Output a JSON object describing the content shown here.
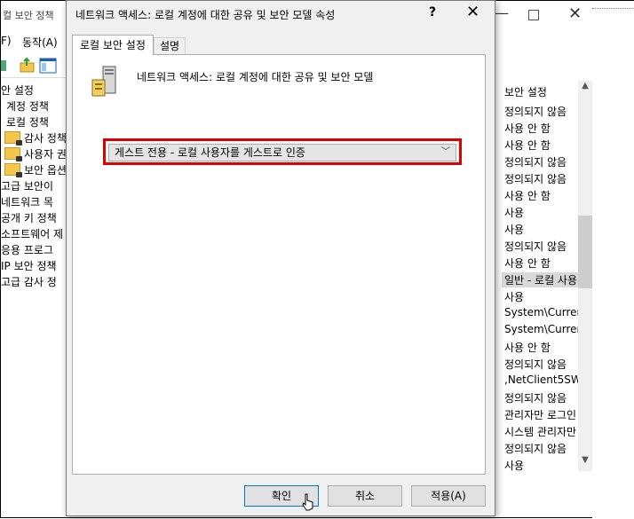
{
  "background_window": {
    "title": "컬 보안 정책",
    "menu": [
      "F)",
      "동작(A)"
    ],
    "tree": [
      {
        "label": "안 설정",
        "indent": 0,
        "folder": false
      },
      {
        "label": "계정 정책",
        "indent": 1,
        "folder": false
      },
      {
        "label": "로컬 정책",
        "indent": 1,
        "folder": false
      },
      {
        "label": "감사 정책",
        "indent": 2,
        "folder": true
      },
      {
        "label": "사용자 권",
        "indent": 2,
        "folder": true
      },
      {
        "label": "보안 옵션",
        "indent": 2,
        "folder": true
      },
      {
        "label": "고급 보안이",
        "indent": 0,
        "folder": false
      },
      {
        "label": "네트워크 목",
        "indent": 0,
        "folder": false
      },
      {
        "label": "공개 키 정책",
        "indent": 0,
        "folder": false
      },
      {
        "label": "소프트웨어 제",
        "indent": 0,
        "folder": false
      },
      {
        "label": "응용 프로그",
        "indent": 0,
        "folder": false
      },
      {
        "label": "IP 보안 정책",
        "indent": 0,
        "folder": false
      },
      {
        "label": "고급 감사 정",
        "indent": 0,
        "folder": false
      }
    ],
    "list_header": "보안 설정",
    "list": [
      "정의되지 않음",
      "사용 안 함",
      "사용 안 함",
      "정의되지 않음",
      "정의되지 않음",
      "사용 안 함",
      "사용",
      "사용",
      "정의되지 않음",
      "사용 안 함",
      "일반 - 로컬 사용",
      "사용",
      "System\\Curren",
      "System\\Curren",
      "사용 안 함",
      "정의되지 않음",
      ",NetClient5SW_",
      "정의되지 않음",
      "관리자만 로그인",
      "시스템 관리자만",
      "정의되지 않음",
      "사용"
    ],
    "selected_list_index": 10
  },
  "dialog": {
    "title": "네트워크 액세스: 로컬 계정에 대한 공유 및 보안 모델 속성",
    "help_label": "?",
    "close_label": "✕",
    "tabs": [
      "로컬 보안 설정",
      "설명"
    ],
    "heading": "네트워크 액세스: 로컬 계정에 대한 공유 및 보안 모델",
    "select_value": "게스트 전용 - 로컬 사용자를 게스트로 인증",
    "buttons": {
      "ok": "확인",
      "cancel": "취소",
      "apply": "적용(A)"
    },
    "highlight_color": "#e00000"
  }
}
